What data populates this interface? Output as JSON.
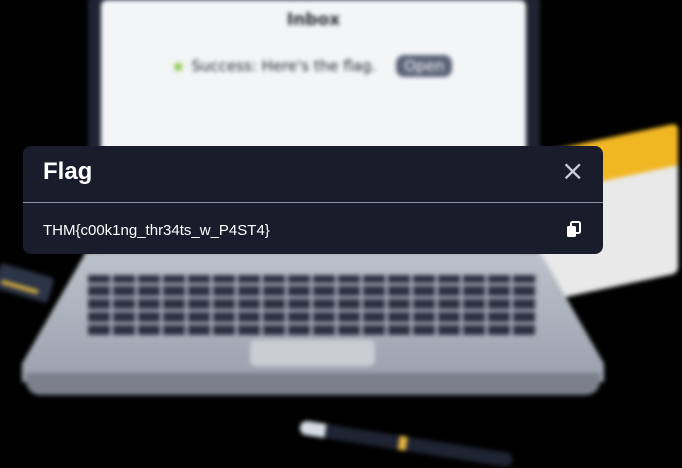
{
  "inbox": {
    "title": "Inbox",
    "message": "Success: Here's the flag.",
    "open_label": "Open"
  },
  "dialog": {
    "title": "Flag",
    "flag": "THM{c00k1ng_thr34ts_w_P4ST4}"
  },
  "icons": {
    "success": "star-icon",
    "close": "close-icon",
    "copy": "copy-icon"
  },
  "colors": {
    "background": "#000000",
    "dialog": "#181c2b",
    "success_star": "#7fc33b",
    "open_button": "#5b6478"
  }
}
